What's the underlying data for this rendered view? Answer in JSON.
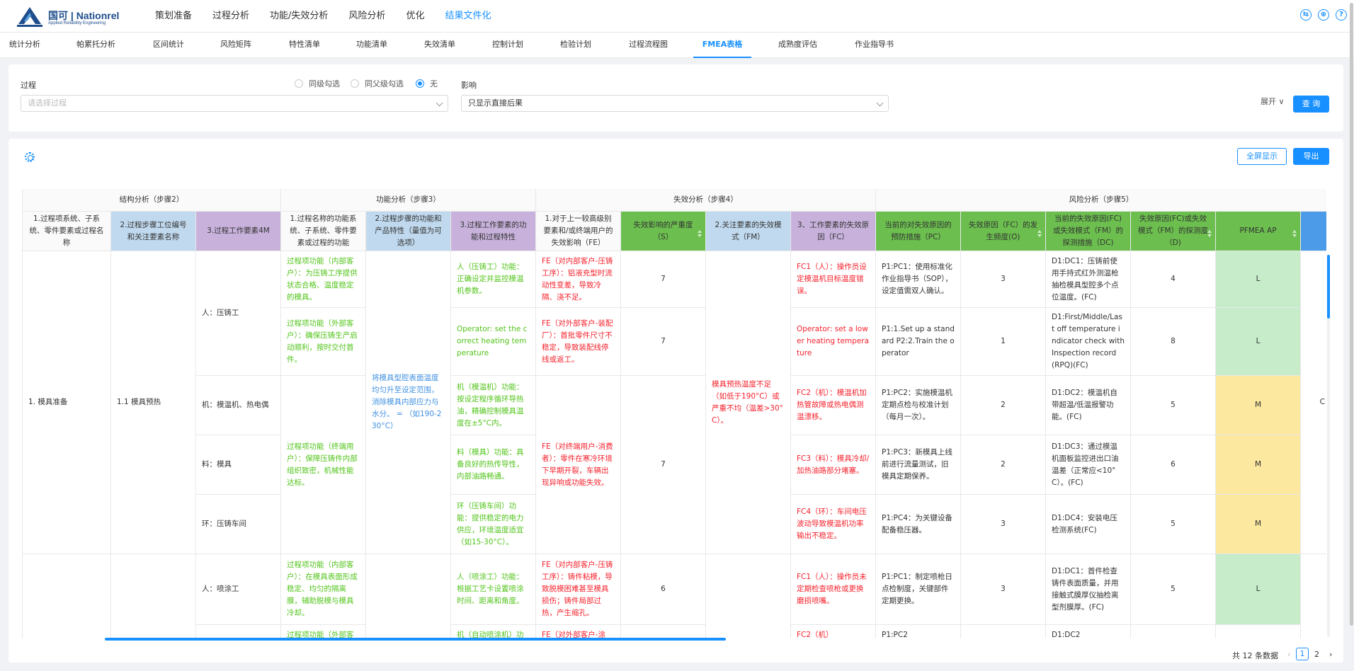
{
  "app": {
    "logo_text": "国可 | Nationrel",
    "logo_sub": "Applied Reliability Engineering"
  },
  "nav": [
    {
      "label": "策划准备"
    },
    {
      "label": "过程分析"
    },
    {
      "label": "功能/失效分析"
    },
    {
      "label": "风险分析"
    },
    {
      "label": "优化"
    },
    {
      "label": "结果文件化"
    }
  ],
  "nav_active": 5,
  "subtabs": [
    {
      "label": "统计分析"
    },
    {
      "label": "帕累托分析"
    },
    {
      "label": "区间统计"
    },
    {
      "label": "风险矩阵"
    },
    {
      "label": "特性清单"
    },
    {
      "label": "功能清单"
    },
    {
      "label": "失效清单"
    },
    {
      "label": "控制计划"
    },
    {
      "label": "检验计划"
    },
    {
      "label": "过程流程图"
    },
    {
      "label": "FMEA表格"
    },
    {
      "label": "成熟度评估"
    },
    {
      "label": "作业指导书"
    }
  ],
  "subtab_active": 10,
  "filter": {
    "process_label": "过程",
    "process_placeholder": "请选择过程",
    "radios": [
      "同级勾选",
      "同父级勾选",
      "无"
    ],
    "radio_selected": 2,
    "effect_label": "影响",
    "effect_value": "只显示直接后果",
    "expand_label": "展开",
    "query_label": "查 询"
  },
  "toolbar": {
    "fullscreen_label": "全屏显示",
    "export_label": "导出"
  },
  "table": {
    "groups": [
      "结构分析（步骤2）",
      "功能分析（步骤3）",
      "失效分析（步骤4）",
      "风险分析（步骤5）"
    ],
    "headers": [
      "1.过程项系统、子系统、零件要素或过程名称",
      "2.过程步骤工位编号和关注要素名称",
      "3.过程工作要素4M",
      "1.过程名称的功能系统、子系统、零件要素或过程的功能",
      "2.过程步骤的功能和产品特性（量值为可选项）",
      "3.过程工作要素的功能和过程特性",
      "1.对于上一较高级别要素和/或终端用户的失效影响（FE）",
      "失效影响的严重度（S）",
      "2.关注要素的失效模式（FM）",
      "3、工作要素的失效原因（FC）",
      "当前的对失效原因的预防措施（PC）",
      "失效原因（FC）的发生频度(O)",
      "当前的失效原因(FC)或失效模式（FM）的探测措施（DC)",
      "失效原因(FC)或失效模式（FM）的探测度（D)",
      "PFMEA AP"
    ],
    "item_1": "1. 模具准备",
    "item_1_1": "1.1 模具预热",
    "work_elements": [
      "人：压铸工",
      "机：模温机、热电偶",
      "料：模具",
      "环：压铸车间",
      "人：喷涂工"
    ],
    "process_functions": [
      "过程项功能（内部客户）：为压铸工序提供状态合格、温度稳定的模具。",
      "过程项功能（外部客户）：确保压铸生产启动顺利，按时交付首件。",
      "过程项功能（终端用户）：保障压铸件内部组织致密，机械性能达标。",
      "过程项功能（内部客户）：在模具表面形成稳定、均匀的隔离膜，辅助脱模与模具冷却。",
      "过程项功能（外部客"
    ],
    "step_function": "将模具型腔表面温度均匀升至设定范围，消除模具内部应力与水分。 = （如190-230°C）",
    "element_functions": [
      "人（压铸工）功能：正确设定并监控模温机参数。",
      "Operator: set the correct heating temperature",
      "机（模温机）功能：按设定程序循环导热油，精确控制模具温度在±5°C内。",
      "料（模具）功能：具备良好的热传导性，内部油路畅通。",
      "环（压铸车间）功能：提供稳定的电力供应，环境温度适宜（如15-30°C）。",
      "人（喷涂工）功能：根据工艺卡设置喷涂时间、距离和角度。",
      "机（自动喷涂机）功"
    ],
    "effects": [
      "FE（对内部客户-压铸工序）：铝液充型时流动性变差，导致冷隔、浇不足。",
      "FE（对外部客户-装配厂）：首批零件尺寸不稳定，导致装配线停线或返工。",
      "FE（对终端用户-消费者）：零件在寒冷环境下早期开裂，车辆出现异响或功能失效。",
      "FE（对内部客户-压铸工序）：铸件粘模，导致脱模困难甚至模具损伤；铸件局部过热，产生缩孔。",
      "FE（对外部客户-涂"
    ],
    "severity": [
      "7",
      "7",
      "7",
      "6"
    ],
    "failure_mode": "模具预热温度不足（如低于190°C）或严重不均（温差>30°C）。",
    "causes": [
      "FC1（人）：操作员设定模温机目标温度错误。",
      "Operator: set a lower heating temperature",
      "FC2（机）：模温机加热管故障或热电偶测温漂移。",
      "FC3（料）：模具冷却/加热油路部分堵塞。",
      "FC4（环）：车间电压波动导致模温机功率输出不稳定。",
      "FC1（人）：操作员未定期检查喷枪或更换磨损喷嘴。",
      "FC2（机）"
    ],
    "prevention": [
      "P1:PC1：使用标准化作业指导书（SOP），设定值需双人确认。",
      "P1:1.Set up a standard P2:2.Train the operator",
      "P1:PC2：实施模温机定期点检与校准计划（每月一次）。",
      "P1:PC3：新模具上线前进行流量测试，旧模具定期保养。",
      "P1:PC4：为关键设备配备稳压器。",
      "P1:PC1：制定喷枪日点检制度，关键部件定期更换。",
      "P1:PC2"
    ],
    "occurrence": [
      "3",
      "1",
      "2",
      "2",
      "3",
      "3"
    ],
    "detection_measures": [
      "D1:DC1：压铸前使用手持式红外测温枪抽检模具型腔多个点位温度。(FC)",
      "D1:First/Middle/Last off temperature indicator check with Inspection record (RPQ)(FC)",
      "D1:DC2：模温机自带超温/低温报警功能。(FC)",
      "D1:DC3：通过模温机面板监控进出口油温差（正常应<10°C）。(FC)",
      "D1:DC4：安装电压检测系统(FC)",
      "D1:DC1：首件检查铸件表面质量，并用接触式膜厚仪抽检离型剂膜厚。(FC)",
      "D1:DC2"
    ],
    "detection": [
      "4",
      "8",
      "5",
      "6",
      "5",
      "5"
    ],
    "ap": [
      "L",
      "L",
      "M",
      "M",
      "M",
      "L"
    ],
    "overflow_char": "C"
  },
  "pager": {
    "total": "共 12 条数据",
    "pages": [
      "1",
      "2"
    ],
    "current": "1"
  },
  "colors": {
    "accent": "#1890ff",
    "header_blue": "#c0d9ee",
    "header_purple": "#c8b2dc",
    "header_green": "#6cbf4f",
    "text_green": "#52c41a",
    "text_blue": "#4090e0",
    "text_red": "#f5222d",
    "ap_low": "#c6ecca",
    "ap_medium": "#fde8a0"
  },
  "icons": {
    "settings": "gear-icon",
    "expand": "chevron-down-icon",
    "top_right": [
      "translate-icon",
      "globe-icon",
      "help-icon"
    ]
  }
}
